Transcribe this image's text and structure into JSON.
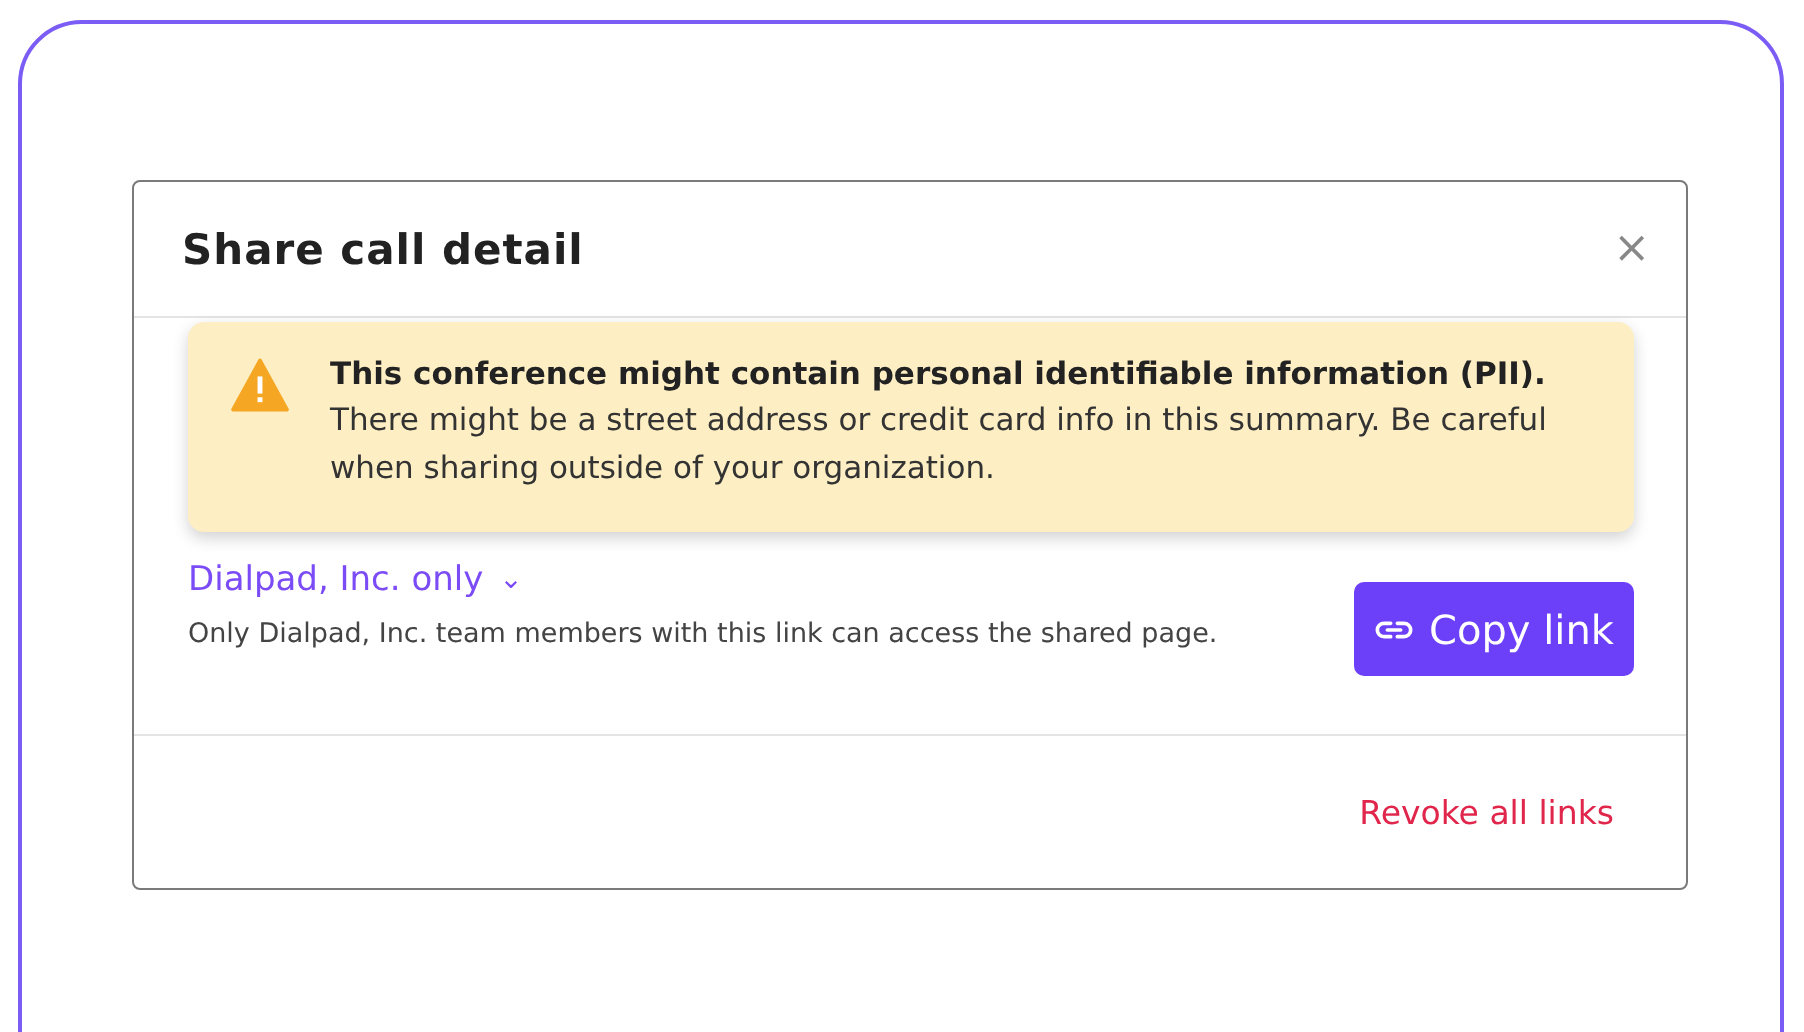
{
  "dialog": {
    "title": "Share call detail",
    "close_label": "×",
    "warning": {
      "heading": "This conference might contain personal identifiable information (PII).",
      "body": "There might be a street address or credit card info in this summary. Be careful when sharing outside of your organization."
    },
    "access": {
      "value": "Dialpad, Inc. only",
      "caret": "⌄",
      "description": "Only Dialpad, Inc. team members with this link can access the shared page."
    },
    "copy_button": "Copy link",
    "revoke_link": "Revoke all links"
  }
}
